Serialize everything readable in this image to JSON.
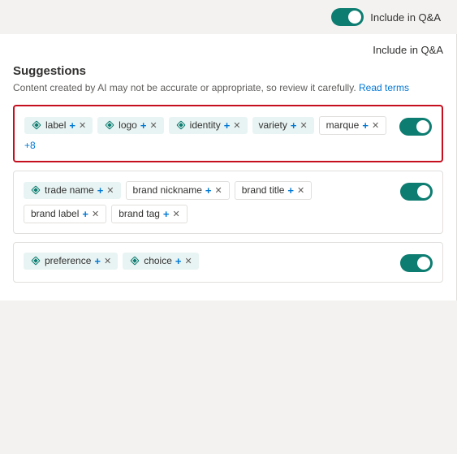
{
  "topBar": {
    "toggleLabel": "Include in Q&A"
  },
  "suggestions": {
    "header": "Suggestions",
    "subtext": "Content created by AI may not be accurate or appropriate, so review it carefully.",
    "readTermsLabel": "Read terms",
    "qnaColumnLabel": "Include in Q&A"
  },
  "cards": [
    {
      "id": "card-1",
      "highlighted": true,
      "tags": [
        {
          "type": "teal",
          "hasIcon": true,
          "text": "label"
        },
        {
          "type": "teal",
          "hasIcon": true,
          "text": "logo"
        },
        {
          "type": "teal",
          "hasIcon": true,
          "text": "identity"
        },
        {
          "type": "teal",
          "hasIcon": false,
          "text": "variety"
        },
        {
          "type": "white",
          "hasIcon": false,
          "text": "marque"
        }
      ],
      "moreBadge": "+8",
      "toggleOn": true
    },
    {
      "id": "card-2",
      "highlighted": false,
      "tags": [
        {
          "type": "teal",
          "hasIcon": true,
          "text": "trade name"
        },
        {
          "type": "white",
          "hasIcon": false,
          "text": "brand nickname"
        },
        {
          "type": "white",
          "hasIcon": false,
          "text": "brand title"
        },
        {
          "type": "white",
          "hasIcon": false,
          "text": "brand label"
        },
        {
          "type": "white",
          "hasIcon": false,
          "text": "brand tag"
        }
      ],
      "moreBadge": null,
      "toggleOn": true
    },
    {
      "id": "card-3",
      "highlighted": false,
      "tags": [
        {
          "type": "teal",
          "hasIcon": true,
          "text": "preference"
        },
        {
          "type": "teal",
          "hasIcon": true,
          "text": "choice"
        }
      ],
      "moreBadge": null,
      "toggleOn": true
    }
  ]
}
